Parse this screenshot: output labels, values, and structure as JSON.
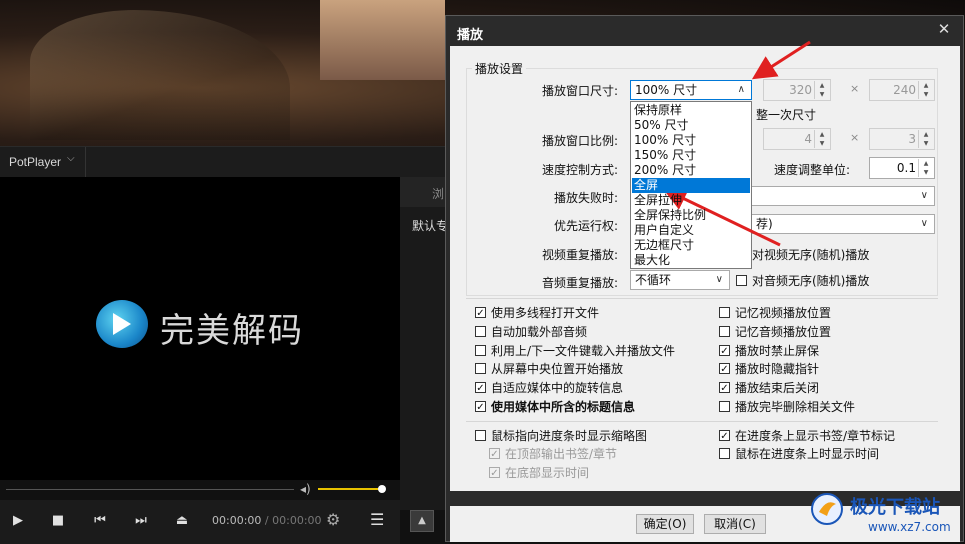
{
  "potplayer": {
    "brand_menu": "PotPlayer",
    "logo_text": "完美解码",
    "side_tab": "浏",
    "side_item": "默认专",
    "time_current": "00:00:00",
    "time_sep": "/",
    "time_total": "00:00:00"
  },
  "dialog": {
    "title": "播放",
    "close": "✕",
    "group_title": "播放设置",
    "window_size_label": "播放窗口尺寸:",
    "window_size_value": "100% 尺寸",
    "width_value": "320",
    "height_value": "240",
    "adjust_once_text": "整一次尺寸",
    "ratio_label": "播放窗口比例:",
    "ratio_a": "4",
    "ratio_b": "3",
    "speed_mode_label": "速度控制方式:",
    "speed_unit_label": "速度调整单位:",
    "speed_unit_value": "0.1",
    "fail_label": "播放失败时:",
    "priority_label": "优先运行权:",
    "priority_value_tail": "荐)",
    "video_repeat_label": "视频重复播放:",
    "video_random_text": "对视频无序(随机)播放",
    "audio_repeat_label": "音频重复播放:",
    "audio_repeat_value": "不循环",
    "audio_random_text": "对音频无序(随机)播放",
    "times_sign": "×",
    "checkboxes_left": [
      {
        "label": "使用多线程打开文件",
        "checked": true
      },
      {
        "label": "自动加载外部音频",
        "checked": false
      },
      {
        "label": "利用上/下一文件键载入并播放文件",
        "checked": false
      },
      {
        "label": "从屏幕中央位置开始播放",
        "checked": false
      },
      {
        "label": "自适应媒体中的旋转信息",
        "checked": true
      },
      {
        "label": "使用媒体中所含的标题信息",
        "checked": true
      }
    ],
    "checkboxes_right": [
      {
        "label": "记忆视频播放位置",
        "checked": false
      },
      {
        "label": "记忆音频播放位置",
        "checked": false
      },
      {
        "label": "播放时禁止屏保",
        "checked": true
      },
      {
        "label": "播放时隐藏指针",
        "checked": true
      },
      {
        "label": "播放结束后关闭",
        "checked": true
      },
      {
        "label": "播放完毕删除相关文件",
        "checked": false
      }
    ],
    "checkboxes_bottom": [
      {
        "label": "鼠标指向进度条时显示缩略图",
        "checked": false
      },
      {
        "label": "在顶部输出书签/章节",
        "checked": true
      },
      {
        "label": "在底部显示时间",
        "checked": true
      },
      {
        "label": "在进度条上显示书签/章节标记",
        "checked": true
      },
      {
        "label": "鼠标在进度条上时显示时间",
        "checked": false
      }
    ],
    "ok_button": "确定(O)",
    "cancel_button": "取消(C)"
  },
  "dropdown": {
    "items": [
      "保持原样",
      "50% 尺寸",
      "100% 尺寸",
      "150% 尺寸",
      "200% 尺寸",
      "全屏",
      "全屏拉伸",
      "全屏保持比例",
      "用户自定义",
      "无边框尺寸",
      "最大化"
    ],
    "selected": "全屏"
  },
  "watermark": {
    "name": "极光下载站",
    "url": "www.xz7.com"
  },
  "colors": {
    "selection": "#0078d7",
    "arrow": "#e02020",
    "dialog_title_bar": "#2b2b2b",
    "volume": "#e8c200"
  }
}
